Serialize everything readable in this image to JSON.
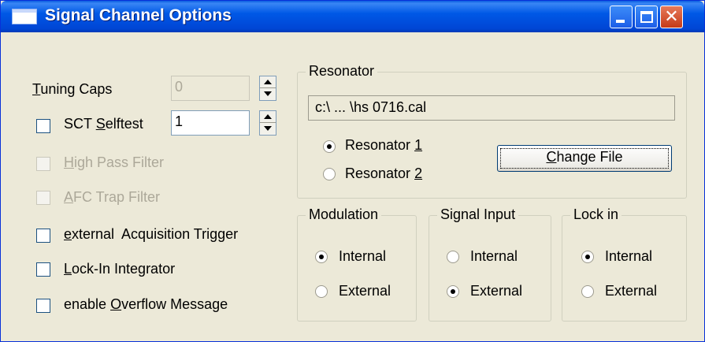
{
  "window": {
    "title": "Signal Channel Options",
    "controls": {
      "minimize": "minimize",
      "maximize": "maximize",
      "close": "✕"
    }
  },
  "left": {
    "tuning_caps": {
      "label_accel": "T",
      "label_rest": "uning Caps",
      "value": "0",
      "enabled": false
    },
    "sct_selftest": {
      "label_accel": "S",
      "label_prefix": "SCT ",
      "label_rest": "elftest",
      "value": "1",
      "checked": false
    },
    "high_pass_filter": {
      "label_accel": "H",
      "label_rest": "igh Pass Filter",
      "checked": false,
      "enabled": false
    },
    "afc_trap_filter": {
      "label_accel": "A",
      "label_rest": "FC Trap Filter",
      "checked": false,
      "enabled": false
    },
    "external_acquisition_trigger": {
      "label_accel": "e",
      "label_rest": "xternal  Acquisition Trigger",
      "checked": false
    },
    "lock_in_integrator": {
      "label_accel": "L",
      "label_rest": "ock-In Integrator",
      "checked": false
    },
    "overflow_message": {
      "label_prefix": "enable ",
      "label_accel": "O",
      "label_rest": "verflow Message",
      "checked": false
    }
  },
  "resonator": {
    "title": "Resonator",
    "file_path": "c:\\ ... \\hs 0716.cal",
    "option1": {
      "label_prefix": "Resonator ",
      "label_accel": "1",
      "selected": true
    },
    "option2": {
      "label_prefix": "Resonator ",
      "label_accel": "2",
      "selected": false
    },
    "change_file": {
      "label_accel": "C",
      "label_rest": "hange File"
    }
  },
  "modulation": {
    "title": "Modulation",
    "internal": "Internal",
    "external": "External",
    "selected": "Internal"
  },
  "signal_input": {
    "title": "Signal Input",
    "internal": "Internal",
    "external": "External",
    "selected": "External"
  },
  "lock_in": {
    "title": "Lock in",
    "internal": "Internal",
    "external": "External",
    "selected": "Internal"
  },
  "colors": {
    "titlebar": "#0058e6",
    "dialog_bg": "#ece9d8",
    "disabled_text": "#aca899",
    "close_button": "#c53a17"
  }
}
